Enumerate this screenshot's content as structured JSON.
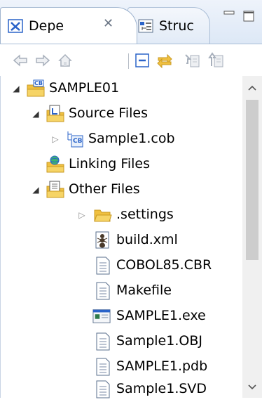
{
  "tabs": {
    "active": {
      "label": "Depe",
      "close": "✕"
    },
    "inactive": {
      "label": "Struc"
    }
  },
  "toolbar": {
    "buttons": [
      "back-icon",
      "forward-icon",
      "home-icon",
      "collapse-all-icon",
      "link-with-editor-icon",
      "next-icon",
      "previous-icon"
    ]
  },
  "tree": {
    "root": {
      "label": "SAMPLE01",
      "badge": "CB"
    },
    "source_files": {
      "label": "Source Files"
    },
    "sample_cob": {
      "label": "Sample1.cob",
      "badge": "CB"
    },
    "linking_files": {
      "label": "Linking Files"
    },
    "other_files": {
      "label": "Other Files"
    },
    "settings": {
      "label": ".settings"
    },
    "build_xml": {
      "label": "build.xml"
    },
    "cobol85": {
      "label": "COBOL85.CBR"
    },
    "makefile": {
      "label": "Makefile"
    },
    "exe": {
      "label": "SAMPLE1.exe"
    },
    "obj": {
      "label": "Sample1.OBJ"
    },
    "pdb": {
      "label": "SAMPLE1.pdb"
    },
    "svd": {
      "label": "Sample1.SVD"
    }
  },
  "colors": {
    "folder": "#f0c040",
    "folder_dark": "#c99a22",
    "doc_border": "#5a6f8c",
    "accent_blue": "#2a63c9",
    "disabled_gray": "#a8b0bc"
  }
}
